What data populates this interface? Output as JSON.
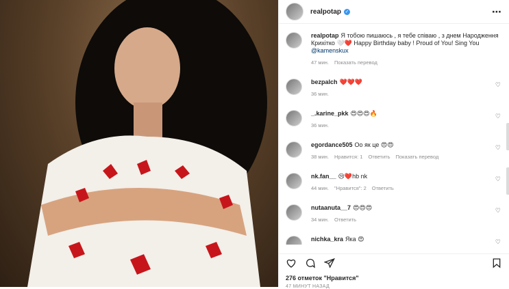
{
  "post": {
    "author": "realpotap",
    "caption_text": "Я тобою пишаюсь , я тебе співаю , з днем Народження Крихітко 🤍❤️ Happy Birthday baby ! Proud of You! Sing You ",
    "caption_mention": "@kamenskux",
    "time": "47 мин.",
    "translate": "Показать перевод"
  },
  "comments": [
    {
      "user": "bezpalch",
      "text": "❤️❤️❤️",
      "time": "36 мин.",
      "likes": "",
      "reply": "",
      "translate": ""
    },
    {
      "user": "_.karine_pkk",
      "text": "😍😍😍🔥",
      "time": "36 мин.",
      "likes": "",
      "reply": "",
      "translate": ""
    },
    {
      "user": "egordance505",
      "text": "Оо як це 😍😍",
      "time": "38 мин.",
      "likes": "Нравится: 1",
      "reply": "Ответить",
      "translate": "Показать перевод"
    },
    {
      "user": "nk.fan__",
      "text": "😢❤️hb nk",
      "time": "44 мин.",
      "likes": "\"Нравится\": 2",
      "reply": "Ответить",
      "translate": ""
    },
    {
      "user": "nutaanuta__7",
      "text": "😍😍😍",
      "time": "34 мин.",
      "likes": "",
      "reply": "Ответить",
      "translate": ""
    },
    {
      "user": "nichka_kra",
      "text": "Яка 😍",
      "time": "",
      "likes": "",
      "reply": "",
      "translate": ""
    }
  ],
  "footer": {
    "likes": "276 отметок \"Нравится\"",
    "posted": "47 МИНУТ НАЗАД"
  },
  "icons": {
    "like": "heart-icon",
    "comment": "comment-icon",
    "share": "share-icon",
    "save": "bookmark-icon",
    "more": "more-icon",
    "verified": "verified-badge-icon"
  }
}
